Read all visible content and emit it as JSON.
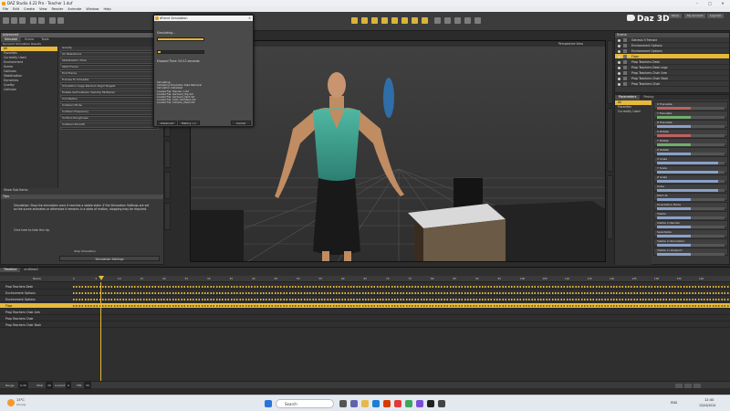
{
  "window": {
    "title": "DAZ Studio 4.22 Pro - Teacher 1.duf"
  },
  "menu": [
    "File",
    "Edit",
    "Create",
    "View",
    "Render",
    "Animate",
    "Window",
    "Help"
  ],
  "brand": {
    "name": "Daz 3D"
  },
  "ribbon_buttons": [
    "Store",
    "My Account",
    "Log Out"
  ],
  "left_panel": {
    "header": "Advanced",
    "tabs": [
      "Simulati",
      "Scene",
      "Tools"
    ],
    "tree_label": "Dynamic Simulation Results",
    "list": [
      "All",
      "Favorites",
      "Currently Used",
      "Environment",
      "Scene",
      "Collision",
      "Stabilization",
      "Dynamics",
      "Quality",
      "Collision"
    ],
    "fields": [
      "Gravity",
      "Air Resistance",
      "Stabilization Time",
      "Start Frame",
      "End Frame",
      "Frames To Simulate",
      "Simulation Cage Random Rigid Targets",
      "Enable Self-Collision Velocity Multiplier",
      "Cull Radius",
      "Collision Mode",
      "Collision Frequency",
      "Surface Roughness",
      "Collision Smooth"
    ],
    "show_sub": "Show Sub Items",
    "tips_title": "Tips",
    "tips_text": "Simulation: Stop the simulation once it reaches a stable state. If the Simulation Settings are set so the scene animates or otherwise it remains in a state of motion, stopping may be required.",
    "tips_link": "Click here to hide this tip.",
    "stop_button": "Stop Simulation",
    "settings_button": "Simulation Settings"
  },
  "dialog": {
    "title": "dForce Simulation",
    "status_label": "Simulating...",
    "elapsed": "Elapsed Time: 00:12 seconds",
    "log": [
      "Simulating...",
      "Initializing Simulation Data Retrieval",
      "Simulation Initialized",
      "Loaded File: Teacher 1.duf",
      "Loaded File: Garment_Top.dsf",
      "Loaded File: Garment_Skirt.dsf",
      "Loaded File: Cloth_Modifiers.dsf",
      "Loaded File: Collision_Mesh.dsf"
    ],
    "buttons": [
      "Advanced",
      "History >>",
      "Cancel"
    ]
  },
  "viewport": {
    "label": "Perspective View"
  },
  "scene_panel": {
    "header": "Scene",
    "items": [
      "Genesis 9 Female",
      "Environment Options",
      "Environment Options",
      "Floor",
      "Prop Teachers Desk",
      "Prop Teachers Desk Legs",
      "Prop Teachers Chair Arm",
      "Prop Teachers Chair Back",
      "Prop Teachers Chair"
    ],
    "selected_index": 3
  },
  "param_panel": {
    "tabs": [
      "Parameters",
      "Posing"
    ],
    "filters": [
      "All",
      "Favorites",
      "Currently Used"
    ],
    "params": [
      "X Translate",
      "Y Translate",
      "Z Translate",
      "X Rotate",
      "Y Rotate",
      "Z Rotate",
      "X Scale",
      "Y Scale",
      "Z Scale",
      "Scale",
      "Point At",
      "Orientation Mode",
      "Visible",
      "Visible in Render",
      "Selectable",
      "Visible in Simulation",
      "Visible in Viewport"
    ],
    "values": [
      0.5,
      0.5,
      0.5,
      0.5,
      0.5,
      0.5,
      0.9,
      0.9,
      0.9,
      0.9,
      0.5,
      0.5,
      0.5,
      0.5,
      0.5,
      0.5,
      0.5
    ],
    "colors": [
      "r",
      "g",
      "",
      "r",
      "g",
      "",
      "",
      "",
      "",
      "",
      "",
      "",
      "",
      "",
      "",
      "",
      ""
    ]
  },
  "timeline": {
    "tabs": [
      "Timeline",
      "aniMate2"
    ],
    "header": "Name",
    "rows": [
      "Prop Teachers Desk",
      "Environment Options",
      "Environment Options",
      "Floor",
      "Prop Teachers Chair Arm",
      "Prop Teachers Chair",
      "Prop Teachers Chair Back"
    ],
    "selected_index": 3,
    "ticks": [
      "0",
      "5",
      "10",
      "15",
      "20",
      "25",
      "30",
      "35",
      "40",
      "45",
      "50",
      "55",
      "60",
      "65",
      "70",
      "75",
      "80",
      "85",
      "90",
      "95",
      "100",
      "105",
      "110",
      "115",
      "120",
      "125",
      "130",
      "135",
      "140"
    ],
    "fps_label": "FPS",
    "fps": "30",
    "range_label": "Range",
    "range": "0-30",
    "current_label": "Current",
    "current": "0",
    "total_label": "Total",
    "total": "30"
  },
  "taskbar": {
    "weather": "13°C",
    "weather_sub": "Cloudy",
    "search_placeholder": "Search",
    "time": "12:40",
    "date": "12/04/2024",
    "lang": "ENG"
  },
  "colors": {
    "accent": "#e6b93b",
    "viewport": "#3b3b3b",
    "panel": "#383838"
  }
}
